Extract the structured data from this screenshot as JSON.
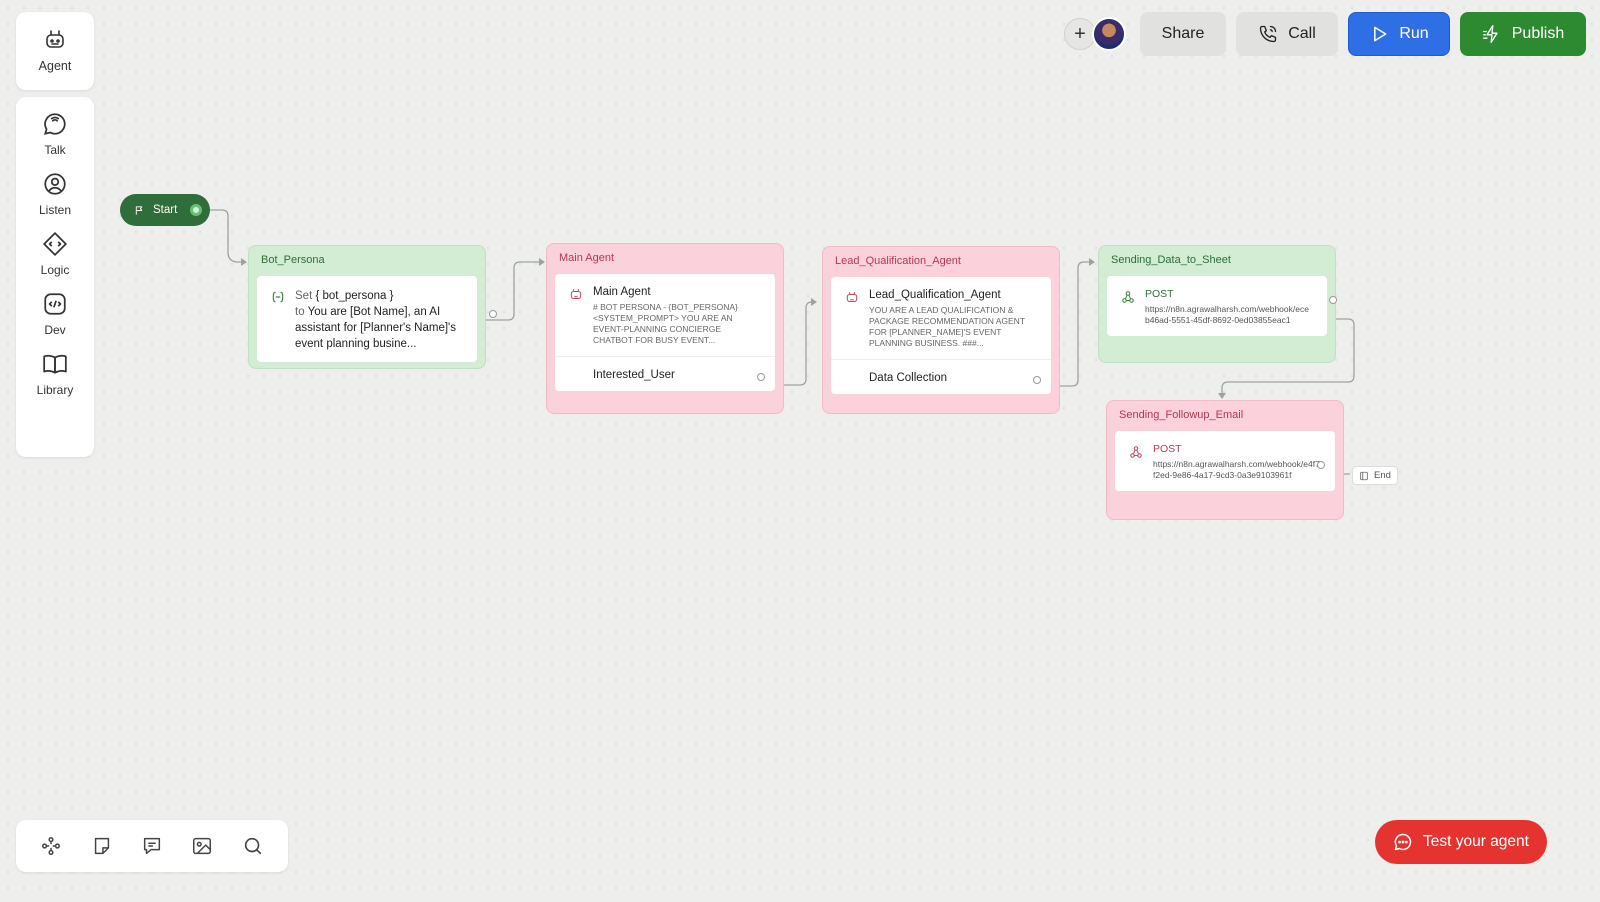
{
  "sidebar": {
    "agent_label": "Agent",
    "items": [
      {
        "label": "Talk",
        "icon": "talk-icon"
      },
      {
        "label": "Listen",
        "icon": "listen-icon"
      },
      {
        "label": "Logic",
        "icon": "logic-icon"
      },
      {
        "label": "Dev",
        "icon": "dev-icon"
      },
      {
        "label": "Library",
        "icon": "library-icon"
      }
    ]
  },
  "topbar": {
    "add_label": "+",
    "share_label": "Share",
    "call_label": "Call",
    "run_label": "Run",
    "publish_label": "Publish"
  },
  "canvas": {
    "start_label": "Start",
    "end_label": "End",
    "nodes": {
      "bot_persona": {
        "title": "Bot_Persona",
        "set_prefix": "Set",
        "variable": "{ bot_persona }",
        "to_prefix": "to",
        "value": "You are [Bot Name], an AI assistant for [Planner's Name]'s event planning busine..."
      },
      "main_agent": {
        "title": "Main Agent",
        "heading": "Main Agent",
        "description": "# Bot Persona - {bot_persona} <system_prompt> YOU ARE AN EVENT-PLANNING CONCIERGE CHATBOT FOR BUSY EVENT...",
        "output": "Interested_User"
      },
      "lead_qualification": {
        "title": "Lead_Qualification_Agent",
        "heading": "Lead_Qualification_Agent",
        "description": "YOU ARE A LEAD QUALIFICATION & PACKAGE RECOMMENDATION AGENT FOR [PLANNER_NAME]'S EVENT PLANNING BUSINESS. ###...",
        "output": "Data Collection"
      },
      "sending_data": {
        "title": "Sending_Data_to_Sheet",
        "method": "POST",
        "url": "https://n8n.agrawalharsh.com/webhook/eceb46ad-5551-45df-8692-0ed03855eac1"
      },
      "sending_followup": {
        "title": "Sending_Followup_Email",
        "method": "POST",
        "url": "https://n8n.agrawalharsh.com/webhook/e4f7f2ed-9e86-4a17-9cd3-0a3e9103961f"
      }
    }
  },
  "bottom_toolbar": {
    "tools": [
      "nodes-icon",
      "sticky-note-icon",
      "comment-icon",
      "image-icon",
      "search-icon"
    ]
  },
  "test_button": {
    "label": "Test your agent"
  },
  "colors": {
    "green_node": "#d3ecd4",
    "pink_node": "#fbd2dc",
    "run": "#2f6fe6",
    "publish": "#2e8a31",
    "test": "#e5342f",
    "start": "#2f6e3a"
  }
}
